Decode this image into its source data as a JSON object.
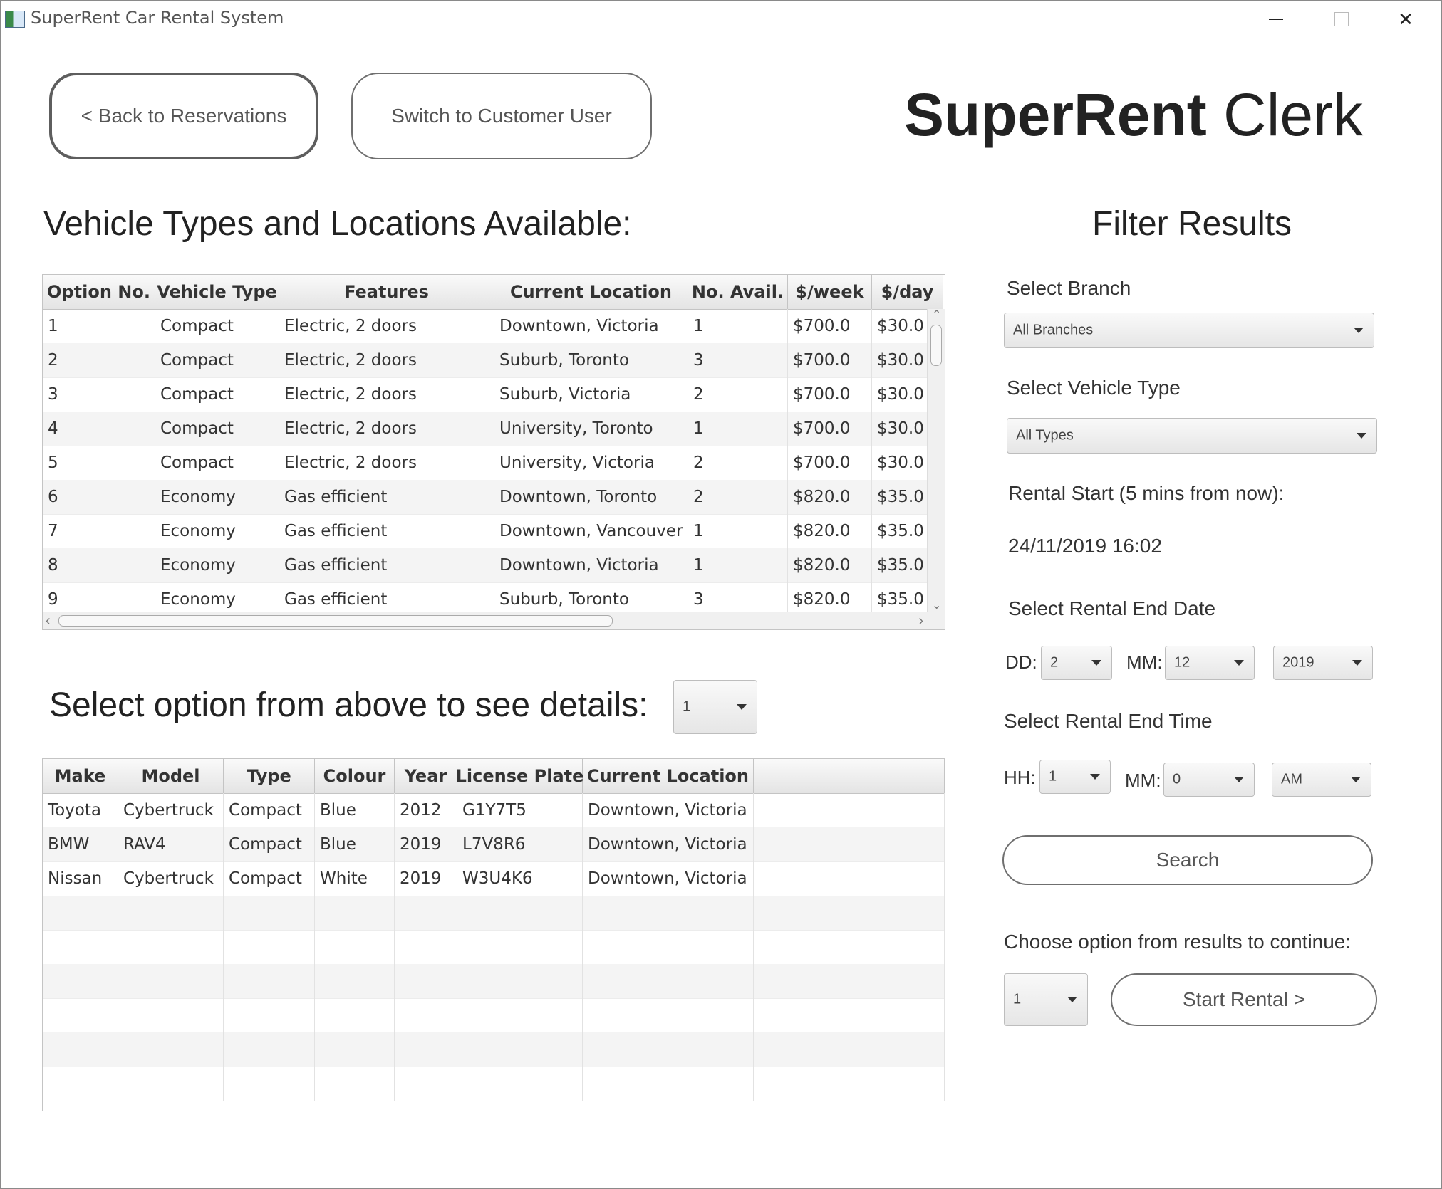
{
  "window": {
    "title": "SuperRent Car Rental System"
  },
  "header": {
    "back_button": "< Back to Reservations",
    "switch_button": "Switch to Customer User",
    "title_bold": "SuperRent",
    "title_rest": " Clerk"
  },
  "vehicles_section": {
    "heading": "Vehicle Types and Locations Available:",
    "columns": [
      "Option No.",
      "Vehicle Type",
      "Features",
      "Current Location",
      "No. Avail.",
      "$/week",
      "$/day"
    ],
    "rows": [
      [
        "1",
        "Compact",
        "Electric, 2 doors",
        "Downtown, Victoria",
        "1",
        "$700.0",
        "$30.0"
      ],
      [
        "2",
        "Compact",
        "Electric, 2 doors",
        "Suburb, Toronto",
        "3",
        "$700.0",
        "$30.0"
      ],
      [
        "3",
        "Compact",
        "Electric, 2 doors",
        "Suburb, Victoria",
        "2",
        "$700.0",
        "$30.0"
      ],
      [
        "4",
        "Compact",
        "Electric, 2 doors",
        "University, Toronto",
        "1",
        "$700.0",
        "$30.0"
      ],
      [
        "5",
        "Compact",
        "Electric, 2 doors",
        "University, Victoria",
        "2",
        "$700.0",
        "$30.0"
      ],
      [
        "6",
        "Economy",
        "Gas efficient",
        "Downtown, Toronto",
        "2",
        "$820.0",
        "$35.0"
      ],
      [
        "7",
        "Economy",
        "Gas efficient",
        "Downtown, Vancouver",
        "1",
        "$820.0",
        "$35.0"
      ],
      [
        "8",
        "Economy",
        "Gas efficient",
        "Downtown, Victoria",
        "1",
        "$820.0",
        "$35.0"
      ],
      [
        "9",
        "Economy",
        "Gas efficient",
        "Suburb, Toronto",
        "3",
        "$820.0",
        "$35.0"
      ]
    ]
  },
  "details_section": {
    "heading": "Select option from above to see details:",
    "selected_option": "1",
    "columns": [
      "Make",
      "Model",
      "Type",
      "Colour",
      "Year",
      "License Plate",
      "Current Location"
    ],
    "rows": [
      [
        "Toyota",
        "Cybertruck",
        "Compact",
        "Blue",
        "2012",
        "G1Y7T5",
        "Downtown, Victoria"
      ],
      [
        "BMW",
        "RAV4",
        "Compact",
        "Blue",
        "2019",
        "L7V8R6",
        "Downtown, Victoria"
      ],
      [
        "Nissan",
        "Cybertruck",
        "Compact",
        "White",
        "2019",
        "W3U4K6",
        "Downtown, Victoria"
      ]
    ]
  },
  "filter": {
    "heading": "Filter Results",
    "branch_label": "Select Branch",
    "branch_value": "All Branches",
    "type_label": "Select Vehicle Type",
    "type_value": "All Types",
    "start_label": "Rental Start (5 mins from now):",
    "start_value": "24/11/2019 16:02",
    "end_date_label": "Select Rental End Date",
    "dd_label": "DD:",
    "dd_value": "2",
    "mm_label": "MM:",
    "mm_value": "12",
    "year_value": "2019",
    "end_time_label": "Select Rental End Time",
    "hh_label": "HH:",
    "hh_value": "1",
    "min_label": "MM:",
    "min_value": "0",
    "ampm_value": "AM",
    "search_button": "Search",
    "continue_label": "Choose option from results to continue:",
    "continue_option": "1",
    "start_rental_button": "Start Rental >"
  }
}
